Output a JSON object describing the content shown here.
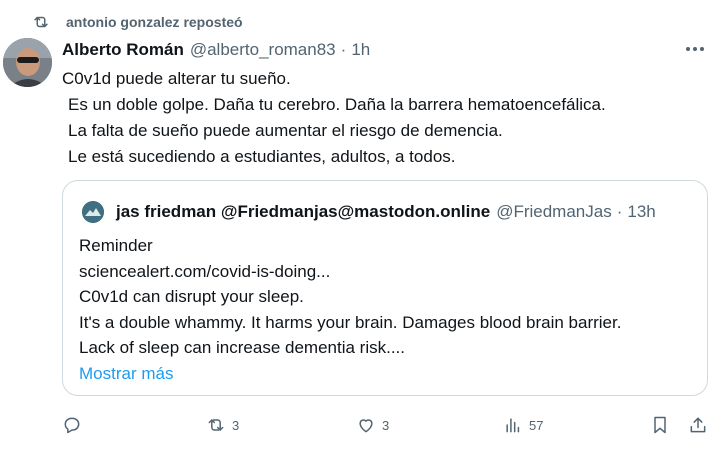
{
  "repost": {
    "icon": "repost-icon",
    "text": "antonio gonzalez reposteó"
  },
  "post": {
    "avatar_icon": "avatar",
    "author": "Alberto Román",
    "handle": "@alberto_roman83",
    "separator": "·",
    "time": "1h",
    "more_icon": "more-icon",
    "lines": [
      "C0v1d puede alterar tu sueño.",
      "Es un doble golpe.  Daña tu cerebro.  Daña la barrera hematoencefálica.",
      "La falta de sueño puede aumentar el riesgo de demencia.",
      "Le está sucediendo a estudiantes, adultos, a todos."
    ]
  },
  "quote": {
    "author": "jas friedman @Friedmanjas@mastodon.online",
    "handle": "@FriedmanJas",
    "separator": "·",
    "time": "13h",
    "lines": [
      "Reminder",
      "sciencealert.com/covid-is-doing...",
      "C0v1d can disrupt your sleep.",
      "It's a double whammy. It harms your brain. Damages blood brain barrier.",
      "Lack of sleep can increase dementia risk...."
    ],
    "show_more": "Mostrar más"
  },
  "actions": {
    "reply": {
      "icon": "reply-icon",
      "count": ""
    },
    "repost": {
      "icon": "repost-icon",
      "count": "3"
    },
    "like": {
      "icon": "heart-icon",
      "count": "3"
    },
    "views": {
      "icon": "views-icon",
      "count": "57"
    },
    "bookmark": {
      "icon": "bookmark-icon"
    },
    "share": {
      "icon": "share-icon"
    }
  },
  "colors": {
    "text": "#0f1419",
    "muted": "#536471",
    "link": "#1d9bf0",
    "border": "#cfd9de"
  }
}
